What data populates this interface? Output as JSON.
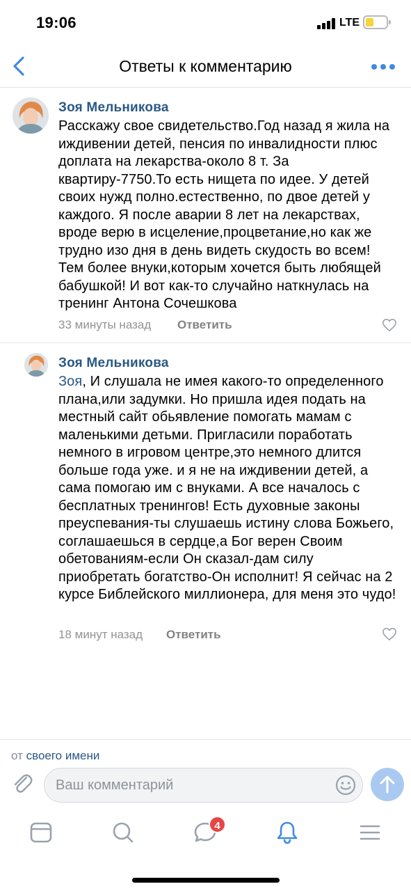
{
  "status_bar": {
    "time": "19:06",
    "network": "LTE",
    "icons": [
      "signal-icon",
      "battery-icon"
    ],
    "battery_color": "#f7d43a"
  },
  "nav": {
    "title": "Ответы к комментарию",
    "icons": [
      "back-chevron-icon",
      "more-icon"
    ],
    "accent_color": "#3f8ae0"
  },
  "comments": [
    {
      "author": "Зоя Мельникова",
      "text": "Расскажу свое свидетельство.Год назад я жила на иждивении детей, пенсия по инвалидности плюс доплата на лекарства-около 8 т. За квартиру-7750.То есть нищета по идее. У детей своих нужд полно.естественно, по двое детей у каждого. Я после аварии 8 лет на лекарствах, вроде верю в исцеление,процветание,но как же трудно изо дня в день видеть скудость во всем! Тем более внуки,которым хочется быть любящей бабушкой! И вот как-то случайно наткнулась на тренинг Антона Сочешкова",
      "time": "33 минуты назад",
      "reply_label": "Ответить"
    },
    {
      "author": "Зоя Мельникова",
      "reply_to": "Зоя",
      "text": ", И слушала не имея какого-то определенного плана,или задумки. Но пришла идея подать на местный сайт обьявление помогать мамам с маленькими детьми. Пригласили поработать немного в игровом центре,это немного длится больше года уже. и я не на иждивении детей, а сама помогаю им с внуками. А все началось с бесплатных тренингов! Есть духовные законы преуспевания-ты слушаешь истину слова Божьего, соглашаешься в сердце,а Бог верен Своим обетованиям-если Он сказал-дам силу приобретать богатство-Он исполнит! Я сейчас на 2 курсе Библейского миллионера, для меня это чудо!",
      "time": "18 минут назад",
      "reply_label": "Ответить"
    }
  ],
  "composer": {
    "from_prefix": "от",
    "from_link": "своего имени",
    "placeholder": "Ваш комментарий",
    "value": "",
    "icons": [
      "attach-icon",
      "emoji-icon",
      "send-arrow-icon"
    ]
  },
  "tab_bar": {
    "tabs": [
      "news-tab",
      "search-tab",
      "messages-tab",
      "notifications-tab",
      "menu-tab"
    ],
    "messages_badge": "4",
    "active_tab": "notifications-tab"
  }
}
